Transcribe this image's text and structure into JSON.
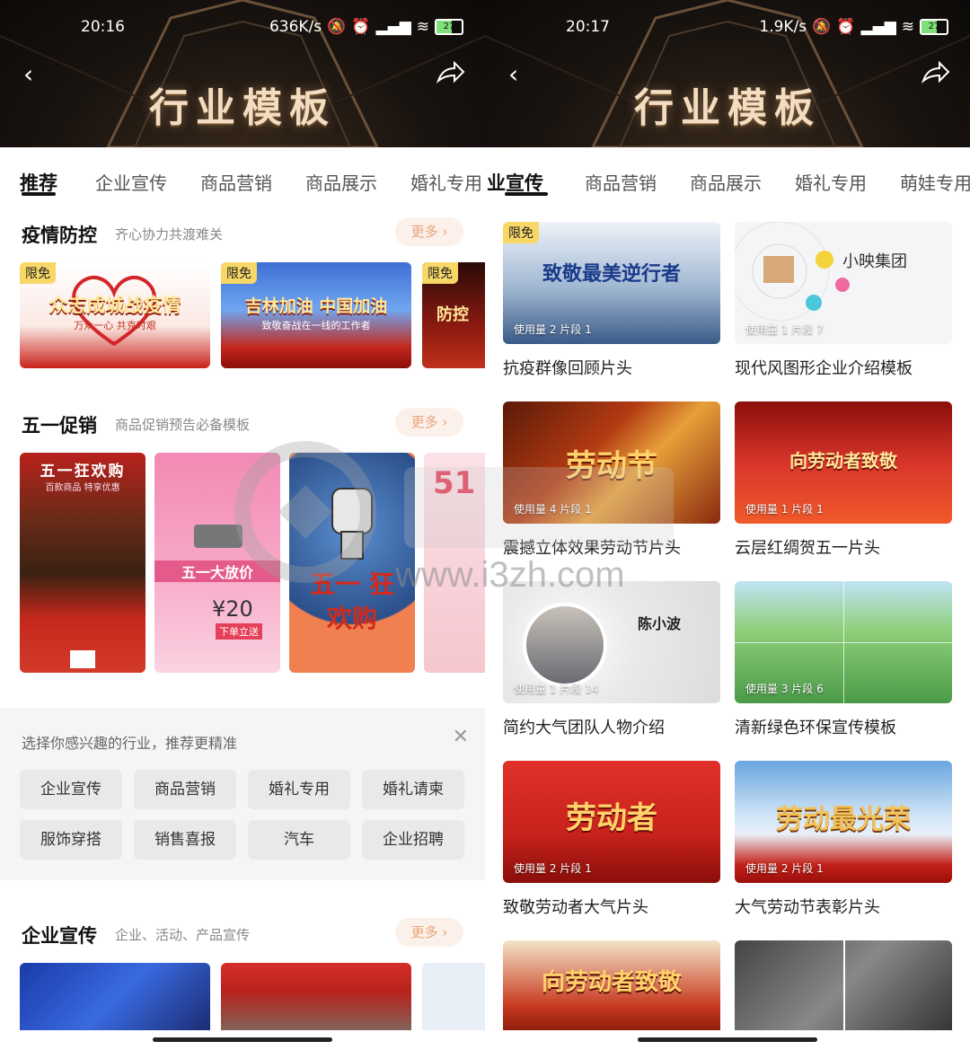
{
  "left": {
    "status": {
      "time": "20:16",
      "speed": "636K/s",
      "battery": "27"
    },
    "header_title": "行业模板",
    "tabs": [
      "推荐",
      "企业宣传",
      "商品营销",
      "商品展示",
      "婚礼专用"
    ],
    "sections": {
      "epidemic": {
        "title": "疫情防控",
        "subtitle": "齐心协力共渡难关",
        "more": "更多",
        "cards": [
          {
            "badge": "限免",
            "text": "众志成城战疫情",
            "sub": "万众一心 共克时艰"
          },
          {
            "badge": "限免",
            "text": "吉林加油 中国加油",
            "sub": "致敬奋战在一线的工作者"
          },
          {
            "badge": "限免",
            "text": "防控"
          }
        ]
      },
      "mayday": {
        "title": "五一促销",
        "subtitle": "商品促销预告必备模板",
        "more": "更多",
        "cards": [
          {
            "text": "五一狂欢购",
            "sub": "百款商品 特享优惠"
          },
          {
            "text": "五一大放价",
            "price": "¥20",
            "sub": "下单立送"
          },
          {
            "text": "五一 狂欢购"
          },
          {
            "text": "51"
          }
        ]
      },
      "enterprise": {
        "title": "企业宣传",
        "subtitle": "企业、活动、产品宣传",
        "more": "更多"
      }
    },
    "preference": {
      "hint": "选择你感兴趣的行业，推荐更精准",
      "chips": [
        "企业宣传",
        "商品营销",
        "婚礼专用",
        "婚礼请柬",
        "服饰穿搭",
        "销售喜报",
        "汽车",
        "企业招聘"
      ]
    }
  },
  "right": {
    "status": {
      "time": "20:17",
      "speed": "1.9K/s",
      "battery": "27"
    },
    "header_title": "行业模板",
    "tabs": [
      "业宣传",
      "商品营销",
      "商品展示",
      "婚礼专用",
      "萌娃专用"
    ],
    "templates": [
      {
        "title": "抗疫群像回顾片头",
        "usage": "使用量 2 片段 1",
        "badge": "限免",
        "art": "致敬最美逆行者",
        "color": "#9fb6d1"
      },
      {
        "title": "现代风图形企业介绍模板",
        "usage": "使用量 1 片段 7",
        "art": "小映集团",
        "color": "#f3f3f3"
      },
      {
        "title": "震撼立体效果劳动节片头",
        "usage": "使用量 4 片段 1",
        "art": "劳动节",
        "color": "#b33a12"
      },
      {
        "title": "云层红绸贺五一片头",
        "usage": "使用量 1 片段 1",
        "art": "向劳动者致敬",
        "color": "#d8352a"
      },
      {
        "title": "简约大气团队人物介绍",
        "usage": "使用量 1 片段 14",
        "art": "陈小波",
        "color": "#ededed"
      },
      {
        "title": "清新绿色环保宣传模板",
        "usage": "使用量 3 片段 6",
        "art": "",
        "color": "#6fb56a"
      },
      {
        "title": "致敬劳动者大气片头",
        "usage": "使用量 2 片段 1",
        "art": "劳动者",
        "color": "#c8221c"
      },
      {
        "title": "大气劳动节表彰片头",
        "usage": "使用量 2 片段 1",
        "art": "劳动最光荣",
        "color": "#7fb0e0"
      },
      {
        "title": "",
        "usage": "",
        "art": "向劳动者致敬",
        "color": "#c73a1f"
      },
      {
        "title": "",
        "usage": "",
        "art": "",
        "color": "#555"
      }
    ]
  },
  "watermark": {
    "site": "www.i3zh.com"
  }
}
